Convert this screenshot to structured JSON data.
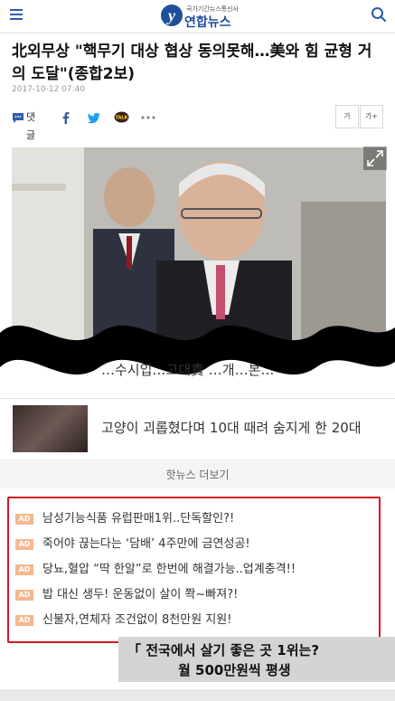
{
  "header": {
    "logo_sub": "국가기간뉴스통신사",
    "logo_mark": "y",
    "logo_text": "연합뉴스"
  },
  "article": {
    "headline": "北외무상 \"핵무기 대상 협상 동의못해…美와 힘 균형 거의 도달\"(종합2보)",
    "date": "2017-10-12 07:40"
  },
  "share": {
    "comment_label": "댓글",
    "talk_label": "TALK",
    "font_small": "가",
    "font_large": "가+"
  },
  "partial_story": "…수시입…고대責 …개…본…",
  "story": {
    "title": "고양이 괴롭혔다며 10대 때려 숨지게 한 20대"
  },
  "hotnews_more": "핫뉴스 더보기",
  "ads": {
    "tag": "AD",
    "items": [
      "남성기능식품 유럽판매1위..단독할인?!",
      "죽어야 끊는다는 ‘담배’ 4주만에 금연성공!",
      "당뇨,혈압 “딱 한알”로 한번에 해결가능..업계충격!!",
      "밥 대신 생두! 운동없이 살이 쫙~빠져?!",
      "신불자,연체자 조건없이 8천만원 지원!"
    ]
  },
  "banner": {
    "line1": "「 전국에서 살기 좋은 곳 1위는?",
    "line2": "월 500만원씩 평생"
  },
  "colors": {
    "brand": "#1f4f9a",
    "ad_border": "#d0181f",
    "ad_tag": "#f5b88d"
  }
}
